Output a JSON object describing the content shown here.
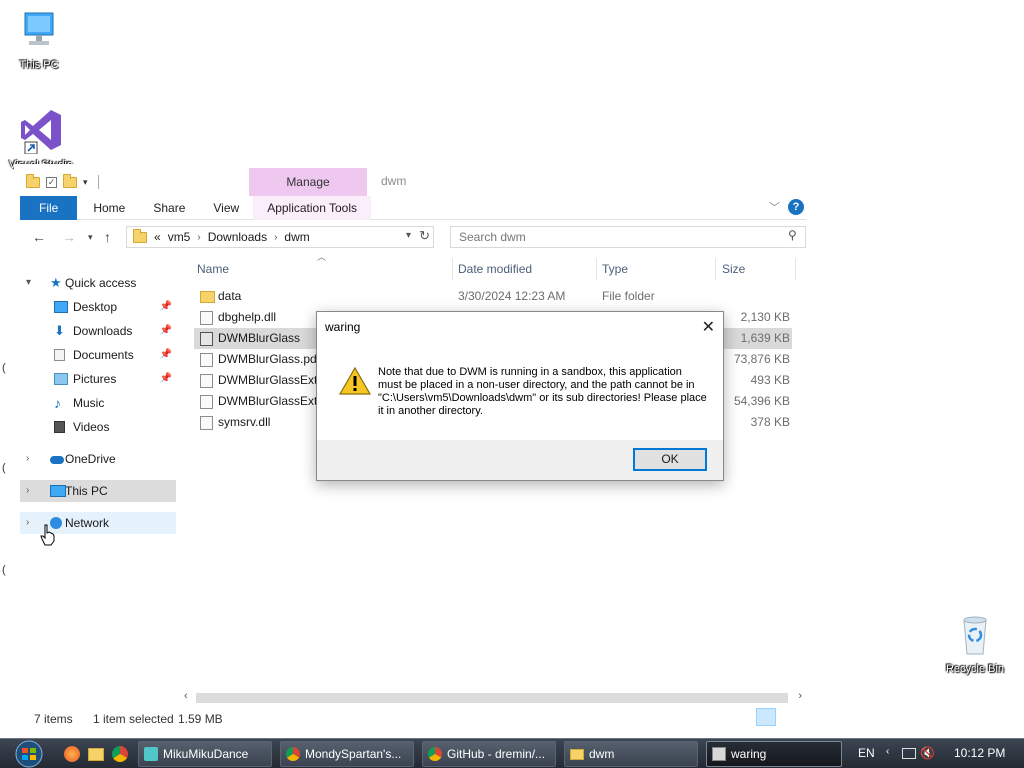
{
  "desktop": {
    "icons": [
      {
        "label": "This PC",
        "icon": "monitor-icon"
      },
      {
        "label": "Visual Studio",
        "icon": "visual-studio-icon"
      },
      {
        "label": "Recycle Bin",
        "icon": "recycle-bin-icon"
      }
    ]
  },
  "explorer": {
    "title": "dwm",
    "manage_label": "Manage",
    "ribbon_tabs": [
      "File",
      "Home",
      "Share",
      "View",
      "Application Tools"
    ],
    "address": {
      "overflow": "«",
      "crumbs": [
        "vm5",
        "Downloads",
        "dwm"
      ]
    },
    "search_placeholder": "Search dwm",
    "nav": {
      "quick_access": "Quick access",
      "quick_items": [
        {
          "label": "Desktop",
          "pinned": true
        },
        {
          "label": "Downloads",
          "pinned": true
        },
        {
          "label": "Documents",
          "pinned": true
        },
        {
          "label": "Pictures",
          "pinned": true
        },
        {
          "label": "Music",
          "pinned": false
        },
        {
          "label": "Videos",
          "pinned": false
        }
      ],
      "onedrive": "OneDrive",
      "this_pc": "This PC",
      "network": "Network"
    },
    "columns": [
      "Name",
      "Date modified",
      "Type",
      "Size"
    ],
    "files": [
      {
        "name": "data",
        "date": "3/30/2024 12:23 AM",
        "type": "File folder",
        "size": ""
      },
      {
        "name": "dbghelp.dll",
        "date": "",
        "type": "",
        "size": "2,130 KB"
      },
      {
        "name": "DWMBlurGlass",
        "date": "",
        "type": "",
        "size": "1,639 KB"
      },
      {
        "name": "DWMBlurGlass.pdb",
        "date": "",
        "type": "",
        "size": "73,876 KB"
      },
      {
        "name": "DWMBlurGlassExt.",
        "date": "",
        "type": "",
        "size": "493 KB"
      },
      {
        "name": "DWMBlurGlassExt.",
        "date": "",
        "type": "",
        "size": "54,396 KB"
      },
      {
        "name": "symsrv.dll",
        "date": "",
        "type": "",
        "size": "378 KB"
      }
    ],
    "status": {
      "count": "7 items",
      "selected": "1 item selected",
      "size": "1.59 MB"
    }
  },
  "dialog": {
    "title": "waring",
    "message": "Note that due to DWM is running in a sandbox, this application must be placed in a non-user directory, and the path cannot be in \"C:\\Users\\vm5\\Downloads\\dwm\" or its sub directories! Please place it in another directory.",
    "ok_label": "OK"
  },
  "taskbar": {
    "buttons": [
      {
        "label": "MikuMikuDance",
        "icon": "mmd-icon"
      },
      {
        "label": "MondySpartan's...",
        "icon": "chrome-icon"
      },
      {
        "label": "GitHub - dremin/...",
        "icon": "chrome-icon"
      },
      {
        "label": "dwm",
        "icon": "folder-icon"
      },
      {
        "label": "waring",
        "icon": "app-icon"
      }
    ],
    "language": "EN",
    "time": "10:12 PM"
  }
}
